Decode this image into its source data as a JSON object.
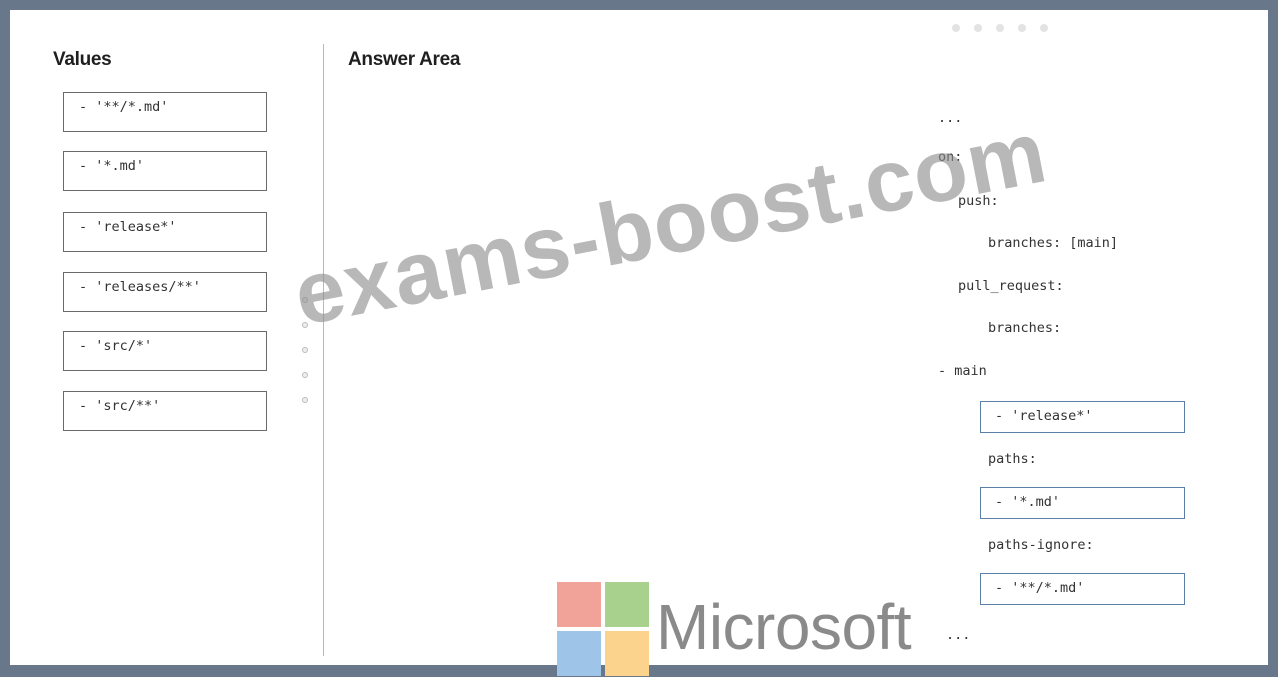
{
  "values_panel": {
    "heading": "Values",
    "items": [
      "- '**/*.md'",
      "- '*.md'",
      "- 'release*'",
      "- 'releases/**'",
      "- 'src/*'",
      "- 'src/**'"
    ]
  },
  "answer_panel": {
    "heading": "Answer Area",
    "code_lines": {
      "ellipsis_top": "...",
      "on": "on:",
      "push": "push:",
      "push_branches": "branches: [main]",
      "pull_request": "pull_request:",
      "pr_branches": "branches:",
      "main": "- main",
      "paths": "paths:",
      "paths_ignore": "paths-ignore:",
      "ellipsis_bottom": "..."
    },
    "slots": {
      "branches_slot": "- 'release*'",
      "paths_slot": "- '*.md'",
      "paths_ignore_slot": "- '**/*.md'"
    }
  },
  "watermark": "exams-boost.com",
  "logo": {
    "text": "Microsoft",
    "colors": {
      "red": "#f1a399",
      "green": "#a8d18d",
      "blue": "#9ec5e8",
      "yellow": "#fbd38d"
    }
  }
}
